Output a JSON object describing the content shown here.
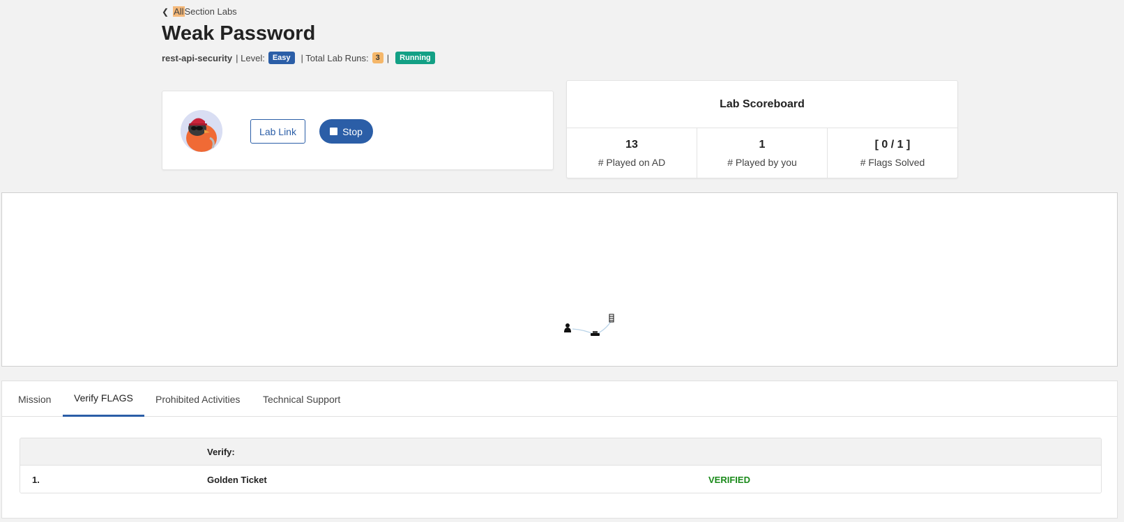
{
  "header": {
    "back_highlight": "All",
    "back_rest": "Section Labs",
    "title": "Weak Password",
    "category": "rest-api-security",
    "level_label": "| Level:",
    "level_value": "Easy",
    "runs_label": "| Total Lab Runs:",
    "runs_value": "3",
    "separator": "|",
    "status": "Running"
  },
  "controls": {
    "lab_link_label": "Lab Link",
    "stop_label": "Stop"
  },
  "scoreboard": {
    "title": "Lab Scoreboard",
    "stats": [
      {
        "value": "13",
        "label": "# Played on AD"
      },
      {
        "value": "1",
        "label": "# Played by you"
      },
      {
        "value": "[ 0 / 1 ]",
        "label": "# Flags Solved"
      }
    ]
  },
  "tabs": {
    "items": [
      {
        "label": "Mission"
      },
      {
        "label": "Verify FLAGS"
      },
      {
        "label": "Prohibited Activities"
      },
      {
        "label": "Technical Support"
      }
    ],
    "active": "Verify FLAGS"
  },
  "flags_table": {
    "header_verify": "Verify:",
    "rows": [
      {
        "index": "1.",
        "name": "Golden Ticket",
        "status": "VERIFIED"
      }
    ]
  },
  "colors": {
    "accent": "#2b5ea7",
    "running": "#13a085",
    "runs_badge": "#f5b76a",
    "verified": "#1a8a1a"
  },
  "icons": {
    "back": "chevron-left-icon",
    "stop": "stop-square-icon",
    "topology_user": "user-node-icon",
    "topology_router": "router-node-icon",
    "topology_server": "server-node-icon"
  }
}
